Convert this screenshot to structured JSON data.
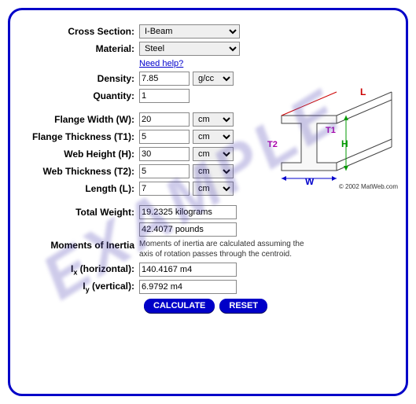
{
  "watermark": "EXAMPLE",
  "labels": {
    "cross_section": "Cross Section:",
    "material": "Material:",
    "need_help": "Need help?",
    "density": "Density:",
    "quantity": "Quantity:",
    "flange_width": "Flange Width (W):",
    "flange_thickness": "Flange Thickness (T1):",
    "web_height": "Web Height (H):",
    "web_thickness": "Web Thickness (T2):",
    "length": "Length (L):",
    "total_weight": "Total Weight:",
    "moments_of_inertia": "Moments of Inertia",
    "ix": "I",
    "ix_sub": "x",
    "ix_suffix": " (horizontal):",
    "iy": "I",
    "iy_sub": "y",
    "iy_suffix": " (vertical):"
  },
  "values": {
    "cross_section": "I-Beam",
    "material": "Steel",
    "density": "7.85",
    "density_unit": "g/cc",
    "quantity": "1",
    "flange_width": "20",
    "flange_thickness": "5",
    "web_height": "30",
    "web_thickness": "5",
    "length": "7",
    "dim_unit": "cm",
    "total_weight_kg": "19.2325 kilograms",
    "total_weight_lb": "42.4077 pounds",
    "inertia_note": "Moments of inertia are calculated assuming the axis of rotation passes through the centroid.",
    "ix": "140.4167 m4",
    "iy": "6.9792 m4"
  },
  "buttons": {
    "calculate": "CALCULATE",
    "reset": "RESET"
  },
  "diagram": {
    "L": "L",
    "T1": "T1",
    "T2": "T2",
    "H": "H",
    "W": "W"
  },
  "copyright": "© 2002 MatWeb.com"
}
